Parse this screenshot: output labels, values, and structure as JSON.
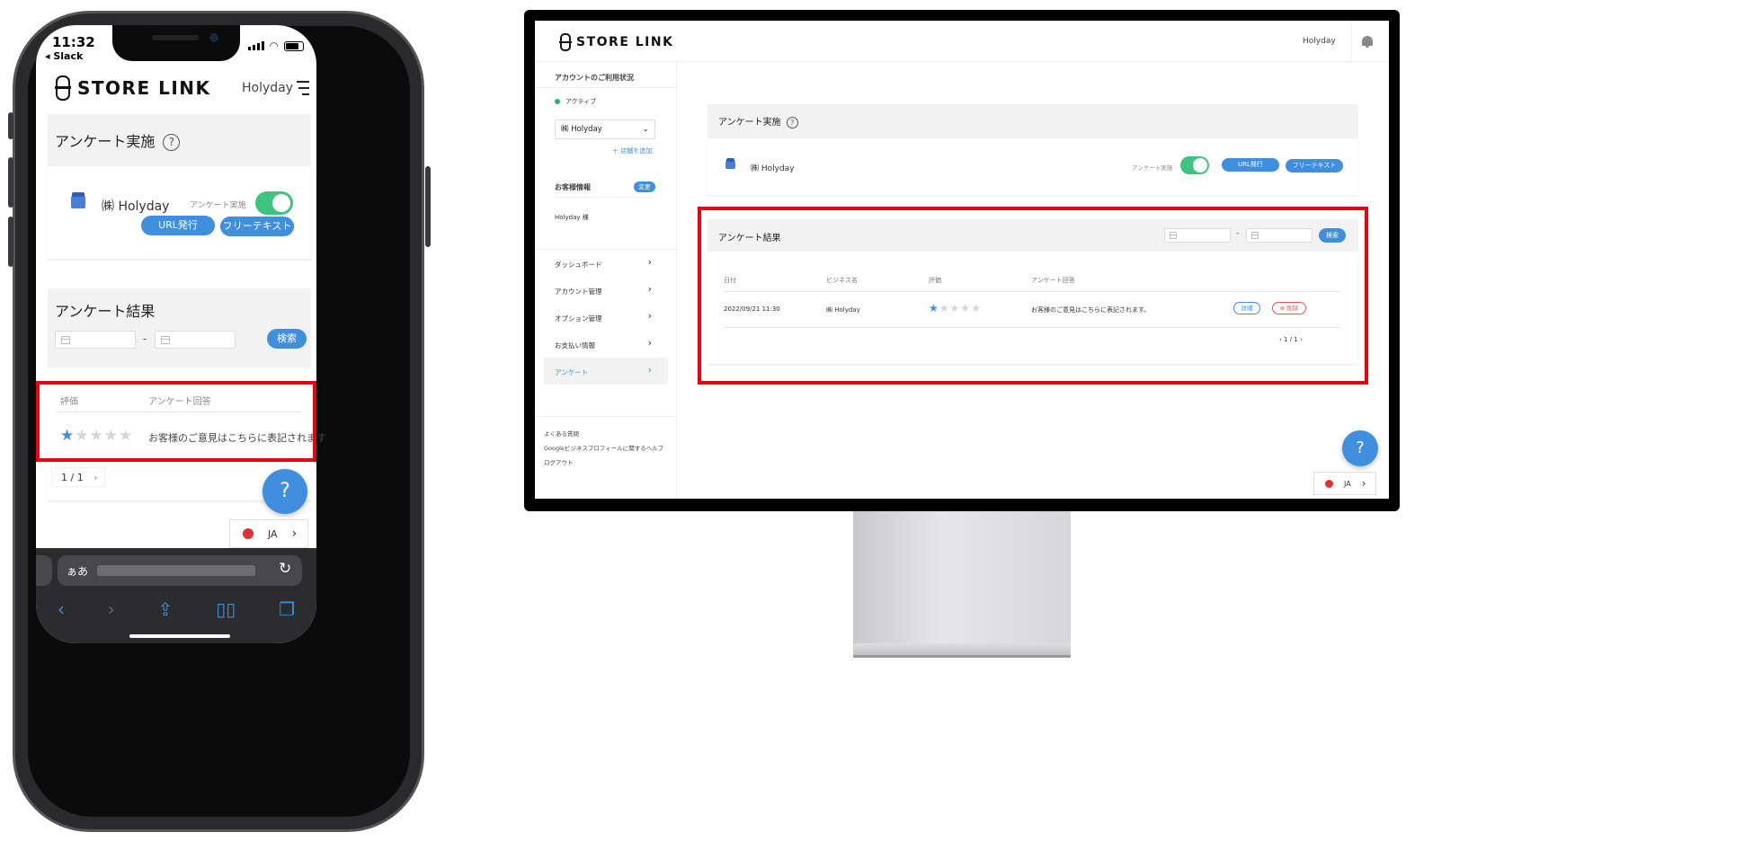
{
  "phone": {
    "status": {
      "time": "11:32",
      "back_app": "◂ Slack"
    },
    "header": {
      "brand": "STORE LINK",
      "user": "Holyday"
    },
    "survey_card": {
      "title": "アンケート実施",
      "help": "?",
      "business_name": "㈱ Holyday",
      "toggle_label": "アンケート実施",
      "toggle_on": true,
      "url_button": "URL発行",
      "free_text_button": "フリーテキスト"
    },
    "results_card": {
      "title": "アンケート結果",
      "date_separator": "-",
      "search_button": "検索",
      "columns": [
        "評価",
        "アンケート回答"
      ],
      "rows": [
        {
          "rating": 1,
          "answer": "お客様のご意見はこちらに表記されます"
        }
      ],
      "pager": "1 / 1",
      "pager_next": "›"
    },
    "help_button": "?",
    "language": {
      "code": "JA",
      "arrow": "›"
    },
    "safari": {
      "aa": "ぁあ",
      "reload": "↻"
    }
  },
  "desktop": {
    "header": {
      "brand": "STORE LINK",
      "user": "Holyday"
    },
    "sidebar": {
      "account_status_label": "アカウントのご利用状況",
      "status": "アクティブ",
      "business_select": "㈱ Holyday",
      "add_shop": "＋ 店舗を追加",
      "customer_info_label": "お客様情報",
      "change_button": "変更",
      "customer_name": "Holyday 様",
      "nav": [
        {
          "label": "ダッシュボード",
          "active": false
        },
        {
          "label": "アカウント管理",
          "active": false
        },
        {
          "label": "オプション管理",
          "active": false
        },
        {
          "label": "お支払い情報",
          "active": false
        },
        {
          "label": "アンケート",
          "active": true
        }
      ],
      "footer_links": [
        "よくある質問",
        "Googleビジネスプロフィールに関するヘルプ",
        "ログアウト"
      ]
    },
    "survey_card": {
      "title": "アンケート実施",
      "help": "?",
      "business_name": "㈱ Holyday",
      "toggle_label": "アンケート実施",
      "toggle_on": true,
      "url_button": "URL発行",
      "free_text_button": "フリーテキスト"
    },
    "results_card": {
      "title": "アンケート結果",
      "date_separator": "-",
      "search_button": "検索",
      "columns": [
        "日付",
        "ビジネス名",
        "評価",
        "アンケート回答"
      ],
      "rows": [
        {
          "date": "2022/09/21 11:30",
          "business": "㈱ Holyday",
          "rating": 1,
          "answer": "お客様のご意見はこちらに表記されます。",
          "detail_button": "詳細",
          "delete_button": "⊗ 削除"
        }
      ],
      "pager": "‹  1 / 1  ›"
    },
    "help_button": "?",
    "language": {
      "code": "JA",
      "arrow": "›"
    }
  },
  "colors": {
    "accent": "#3f8fde",
    "toggle": "#3ec47e",
    "highlight": "#e60012",
    "delete": "#e05555",
    "active_status": "#2bb179"
  },
  "icons": [
    "calendar-icon",
    "star-icon",
    "bell-icon",
    "chevron-right-icon",
    "chevron-down-icon",
    "help-icon",
    "business-icon",
    "hamburger-menu-icon"
  ]
}
